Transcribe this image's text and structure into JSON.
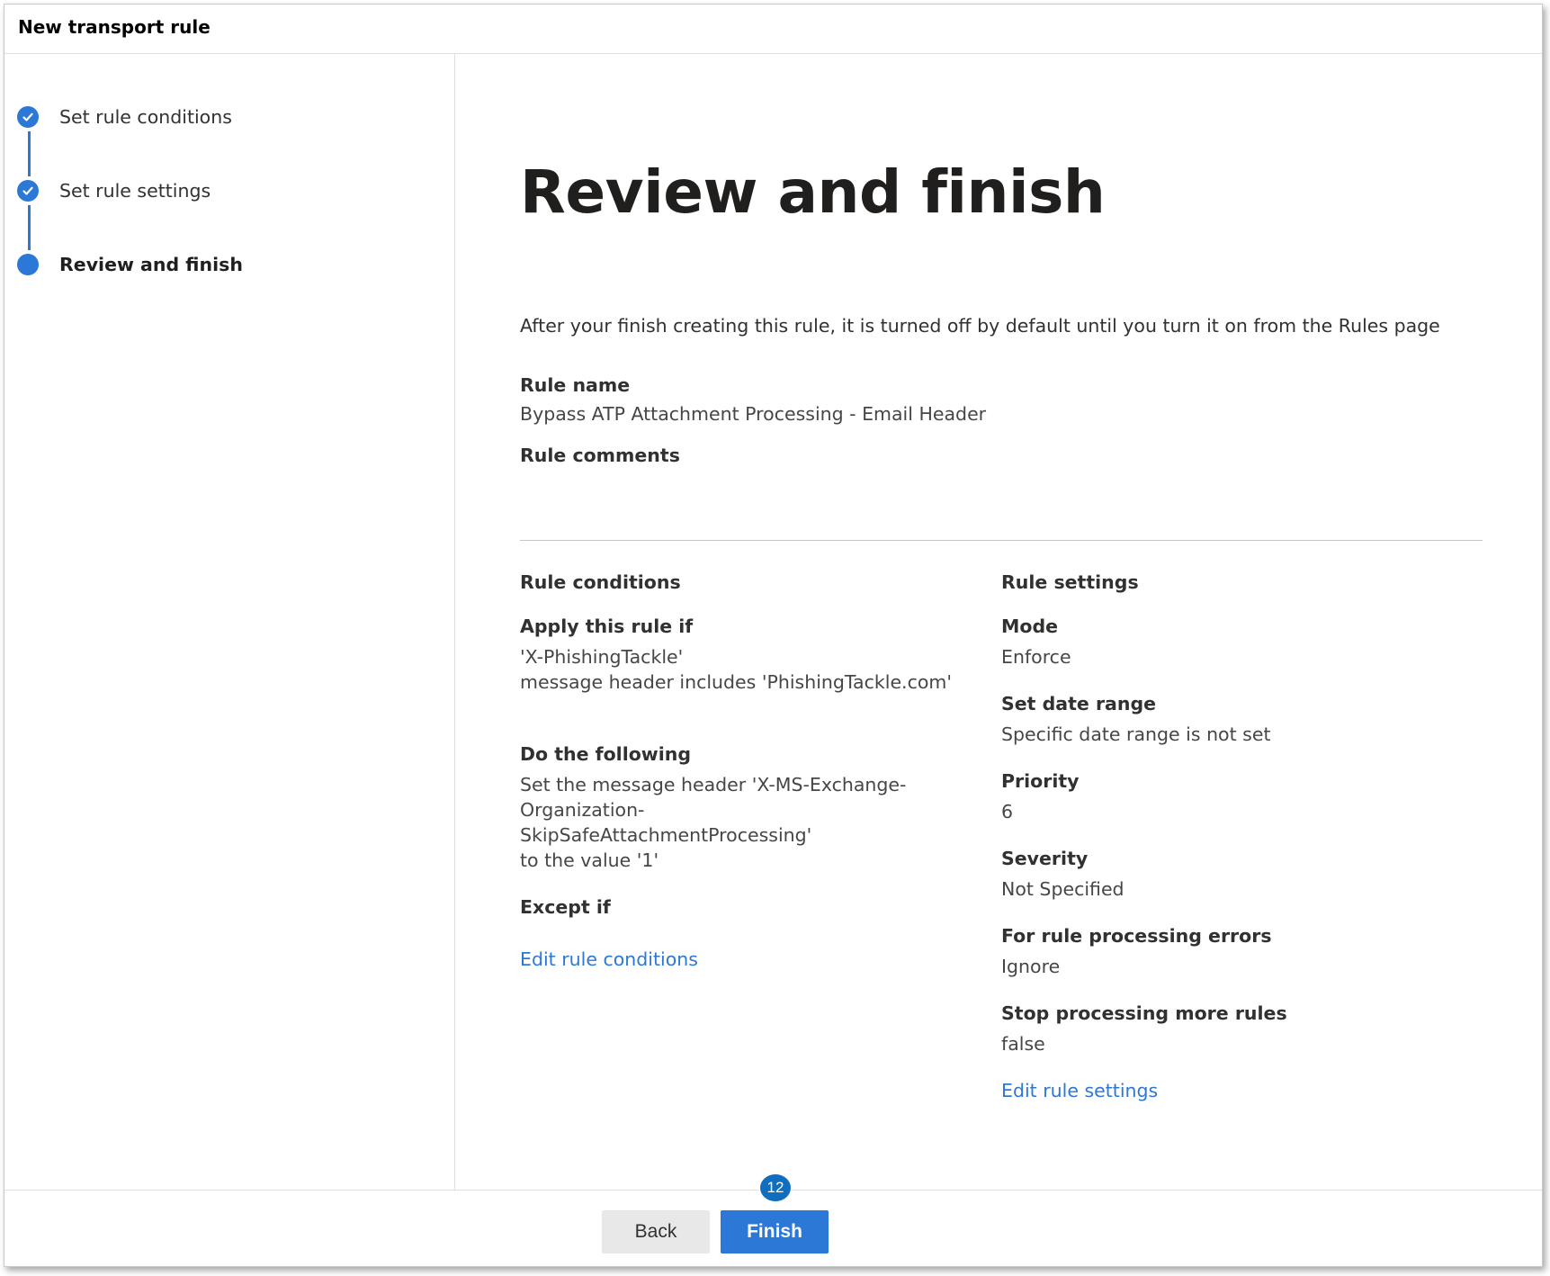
{
  "window": {
    "title": "New transport rule"
  },
  "steps": [
    {
      "label": "Set rule conditions",
      "state": "complete"
    },
    {
      "label": "Set rule settings",
      "state": "complete"
    },
    {
      "label": "Review and finish",
      "state": "current"
    }
  ],
  "page": {
    "heading": "Review and finish",
    "intro": "After your finish creating this rule, it is turned off by default until you turn it on from the Rules page"
  },
  "rule": {
    "name_label": "Rule name",
    "name_value": "Bypass ATP Attachment Processing - Email Header",
    "comments_label": "Rule comments",
    "comments_value": ""
  },
  "conditions": {
    "section_label": "Rule conditions",
    "apply_label": "Apply this rule if",
    "apply_value": " 'X-PhishingTackle'\n message header includes  'PhishingTackle.com'",
    "do_label": "Do the following",
    "do_value": "Set the message header  'X-MS-Exchange-Organization-\nSkipSafeAttachmentProcessing'\n to the value  '1'",
    "except_label": "Except if",
    "except_value": "",
    "edit_link": "Edit rule conditions"
  },
  "settings": {
    "section_label": "Rule settings",
    "mode_label": "Mode",
    "mode_value": "Enforce",
    "date_label": "Set date range",
    "date_value": "Specific date range is not set",
    "priority_label": "Priority",
    "priority_value": "6",
    "severity_label": "Severity",
    "severity_value": "Not Specified",
    "errors_label": "For rule processing errors",
    "errors_value": "Ignore",
    "stop_label": "Stop processing more rules",
    "stop_value": "false",
    "edit_link": "Edit rule settings"
  },
  "footer": {
    "back_label": "Back",
    "finish_label": "Finish",
    "badge": "12"
  },
  "colors": {
    "accent": "#2b78d6",
    "badge": "#106ebe"
  }
}
